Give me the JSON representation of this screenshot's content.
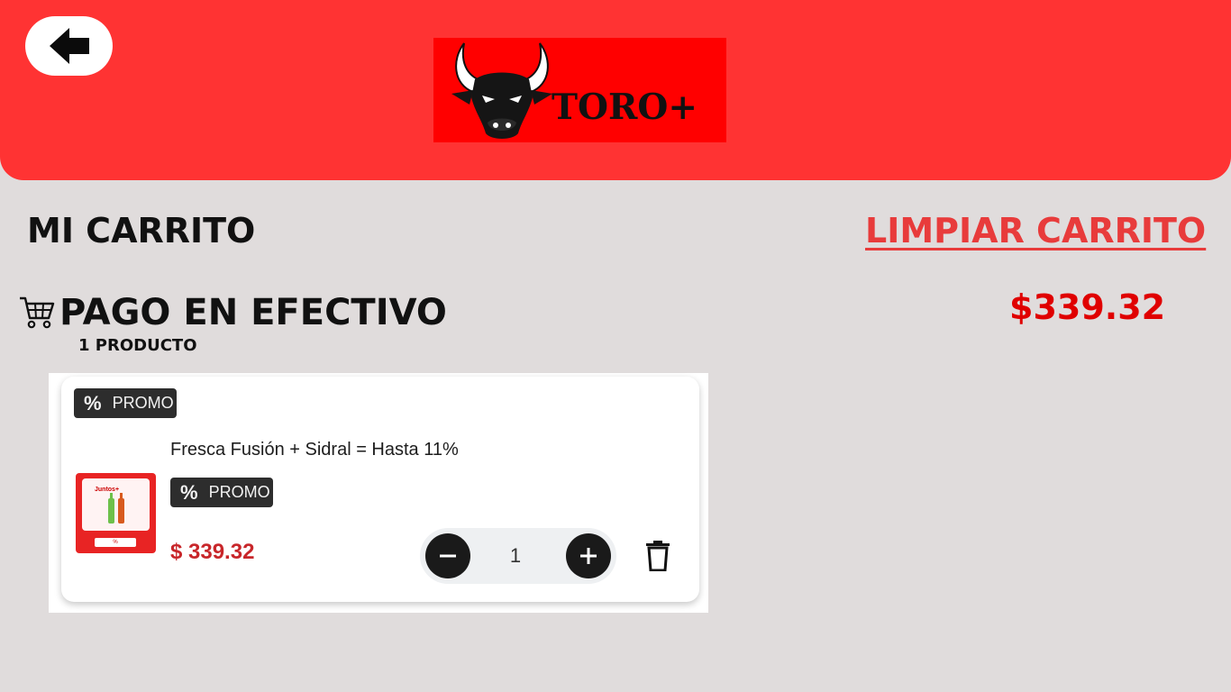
{
  "header": {
    "back_icon": "arrow-left-icon",
    "logo_text": "TORO+",
    "logo_icon": "bull-head-icon",
    "colors": {
      "header_bg": "#ff3333",
      "logo_bg": "#ff0000"
    }
  },
  "cart": {
    "title": "MI CARRITO",
    "clear_label": "LIMPIAR CARRITO",
    "payment_method": "PAGO EN EFECTIVO",
    "payment_icon": "cart-icon",
    "product_count": "1 PRODUCTO",
    "total": "$339.32"
  },
  "item": {
    "promo_badge_top": "PROMO",
    "name": "Fresca Fusión + Sidral = Hasta 11%",
    "promo_badge": "PROMO",
    "price": "$ 339.32",
    "quantity": "1",
    "thumb_label": "Juntos+",
    "icons": {
      "badge": "percent-icon",
      "minus": "minus-icon",
      "plus": "plus-icon",
      "delete": "trash-icon"
    }
  },
  "colors": {
    "page_bg": "#e0dcdc",
    "accent_red": "#e00000",
    "link_red": "#e83b3b",
    "price_red": "#c8262a"
  }
}
